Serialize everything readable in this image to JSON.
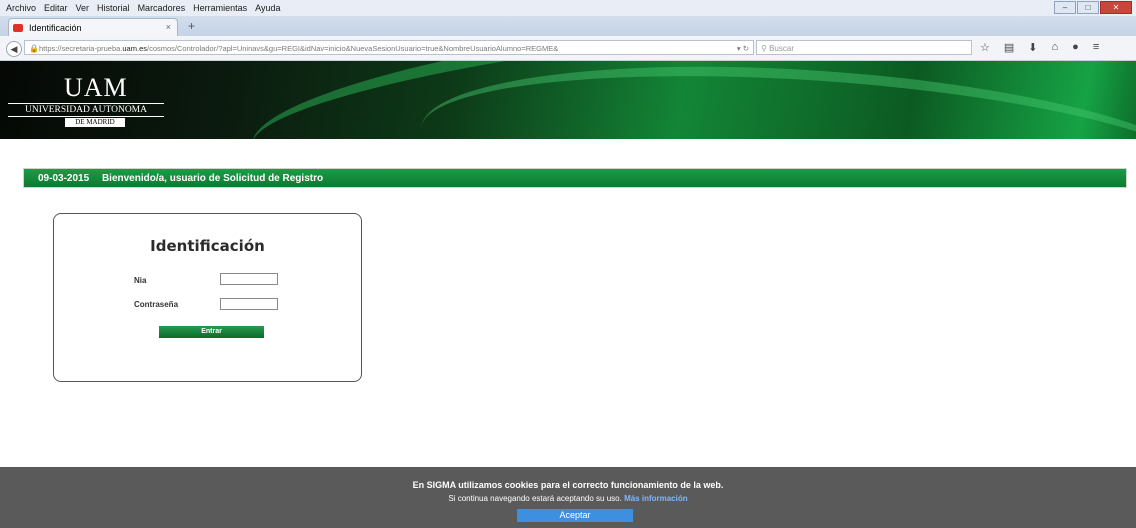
{
  "browser": {
    "menu": [
      "Archivo",
      "Editar",
      "Ver",
      "Historial",
      "Marcadores",
      "Herramientas",
      "Ayuda"
    ],
    "tab_title": "Identificación",
    "tab_close": "×",
    "new_tab": "+",
    "url_prefix": "https://secretaria-prueba.",
    "url_domain": "uam.es",
    "url_rest": "/cosmos/Controlador/?apl=Uninavs&gu=REGI&idNav=inicio&NuevaSesionUsuario=true&NombreUsuarioAlumno=REGME&",
    "search_placeholder": "Buscar"
  },
  "header": {
    "logo_main": "UAM",
    "logo_univ": "UNIVERSIDAD AUTONOMA",
    "logo_madrid": "DE MADRID"
  },
  "welcome": {
    "date": "09-03-2015",
    "message": "Bienvenido/a, usuario de Solicitud de Registro"
  },
  "login": {
    "title": "Identificación",
    "nia_label": "Nia",
    "password_label": "Contraseña",
    "submit_label": "Entrar"
  },
  "cookie_banner": {
    "line1": "En SIGMA utilizamos cookies para el correcto funcionamiento de la web.",
    "line2": "Si continua navegando estará aceptando su uso.",
    "more_link": "Más información",
    "accept_label": "Aceptar"
  },
  "colors": {
    "brand_green": "#0e7a32",
    "cookie_bg": "#5a5a5a",
    "accept_blue": "#3d8fe0"
  }
}
